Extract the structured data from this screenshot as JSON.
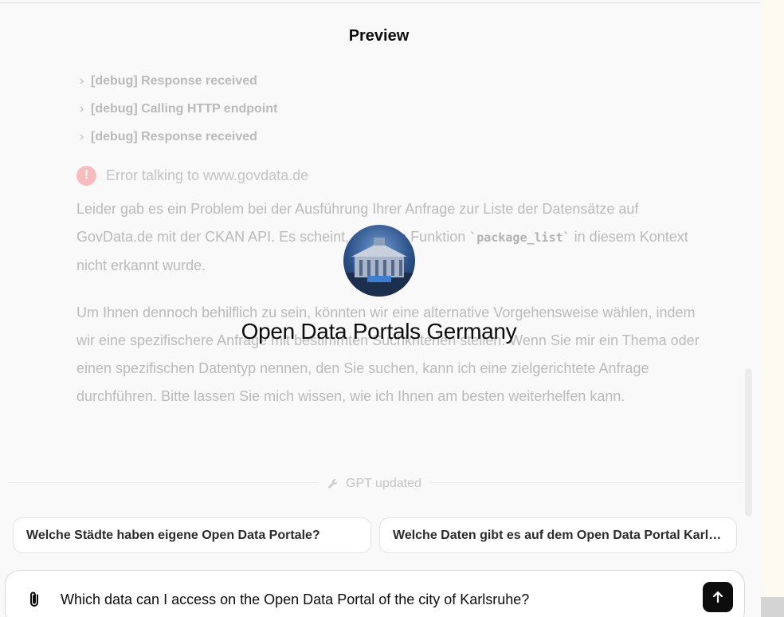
{
  "preview": {
    "title": "Preview"
  },
  "debug": [
    {
      "label": "[debug] Response received"
    },
    {
      "label": "[debug] Calling HTTP endpoint"
    },
    {
      "label": "[debug] Response received"
    }
  ],
  "error": {
    "text": "Error talking to www.govdata.de",
    "icon": "exclamation-icon"
  },
  "message": {
    "p1_before": "Leider gab es ein Problem bei der Ausführung Ihrer Anfrage zur Liste der Datensätze auf GovData.de mit der CKAN API. Es scheint, dass die Funktion ",
    "p1_code": "`package_list`",
    "p1_after": " in diesem Kontext nicht erkannt wurde.",
    "p2": "Um Ihnen dennoch behilflich zu sein, könnten wir eine alternative Vorgehensweise wählen, indem wir eine spezifischere Anfrage mit bestimmten Suchkriterien stellen. Wenn Sie mir ein Thema oder einen spezifischen Datentyp nennen, den Sie suchen, kann ich eine zielgerichtete Anfrage durchführen. Bitte lassen Sie mich wissen, wie ich Ihnen am besten weiterhelfen kann."
  },
  "gpt": {
    "name": "Open Data Portals Germany"
  },
  "updated": {
    "text": "GPT updated"
  },
  "suggestions": [
    {
      "text": "Welche Städte haben eigene Open Data Portale?"
    },
    {
      "text": "Welche Daten gibt es auf dem Open Data Portal Karlsruhe?"
    }
  ],
  "composer": {
    "value": "Which data can I access on the Open Data Portal of the city of Karlsruhe?"
  },
  "colors": {
    "error": "#ef4146",
    "send_button": "#0d0d0d",
    "panel_bg": "#f9f9f9"
  }
}
